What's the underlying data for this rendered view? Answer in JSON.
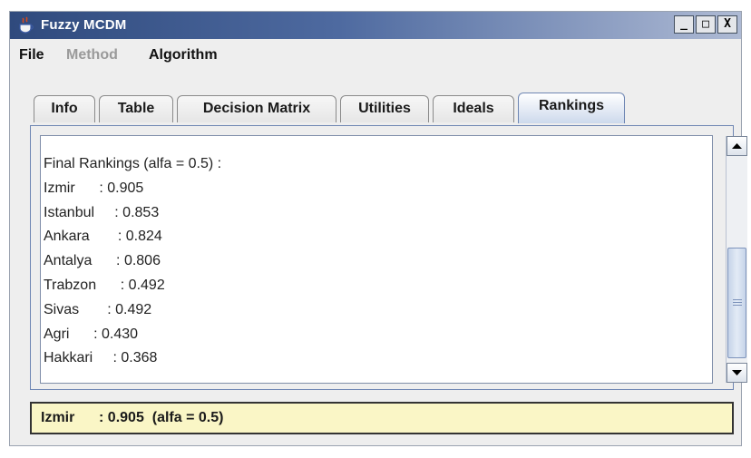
{
  "window": {
    "title": "Fuzzy MCDM",
    "buttons": {
      "minimize": "_",
      "maximize": "□",
      "close": "X"
    }
  },
  "menu": [
    {
      "label": "File",
      "enabled": true
    },
    {
      "label": "Method",
      "enabled": false
    },
    {
      "label": "Algorithm",
      "enabled": true
    }
  ],
  "tabs": [
    {
      "label": "Info",
      "active": false
    },
    {
      "label": "Table",
      "active": false
    },
    {
      "label": "Decision Matrix",
      "active": false
    },
    {
      "label": "Utilities",
      "active": false
    },
    {
      "label": "Ideals",
      "active": false
    },
    {
      "label": "Rankings",
      "active": true
    }
  ],
  "rankings": {
    "heading": "Final Rankings (alfa = 0.5) :",
    "rows": [
      {
        "city": "Izmir",
        "sep": "      : ",
        "value": "0.905"
      },
      {
        "city": "Istanbul",
        "sep": "     : ",
        "value": "0.853"
      },
      {
        "city": "Ankara",
        "sep": "       : ",
        "value": "0.824"
      },
      {
        "city": "Antalya",
        "sep": "      : ",
        "value": "0.806"
      },
      {
        "city": "Trabzon",
        "sep": "      : ",
        "value": "0.492"
      },
      {
        "city": "Sivas",
        "sep": "       : ",
        "value": "0.492"
      },
      {
        "city": "Agri",
        "sep": "      : ",
        "value": "0.430"
      },
      {
        "city": "Hakkari",
        "sep": "     : ",
        "value": "0.368"
      }
    ]
  },
  "status": {
    "city": "Izmir",
    "sep": "      : ",
    "value": "0.905",
    "note": "  (alfa = 0.5)"
  },
  "colors": {
    "title_gradient_start": "#2f4a7d",
    "tab_active": "#cdd9ec",
    "status_background": "#faf6c6"
  },
  "icons": {
    "app": "java-coffee-cup-icon",
    "scroll_up": "arrow-up-icon",
    "scroll_down": "arrow-down-icon"
  }
}
